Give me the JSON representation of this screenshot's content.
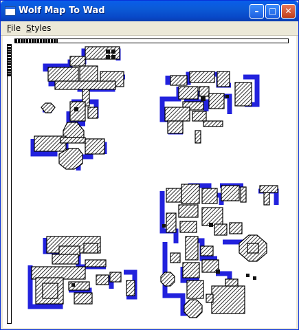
{
  "window": {
    "title": "Wolf Map To Wad"
  },
  "titlebar": {
    "minimize_glyph": "–",
    "maximize_glyph": "□",
    "close_glyph": "✕"
  },
  "menu": {
    "items": [
      "File",
      "Styles"
    ]
  },
  "icons": {
    "app": "app-window-icon",
    "minimize": "minimize-icon",
    "maximize": "maximize-icon",
    "close": "close-icon"
  },
  "colors": {
    "titlebar": "#0a5eea",
    "corridor": "#2222dd",
    "wall": "#000000",
    "background": "#ffffff"
  }
}
